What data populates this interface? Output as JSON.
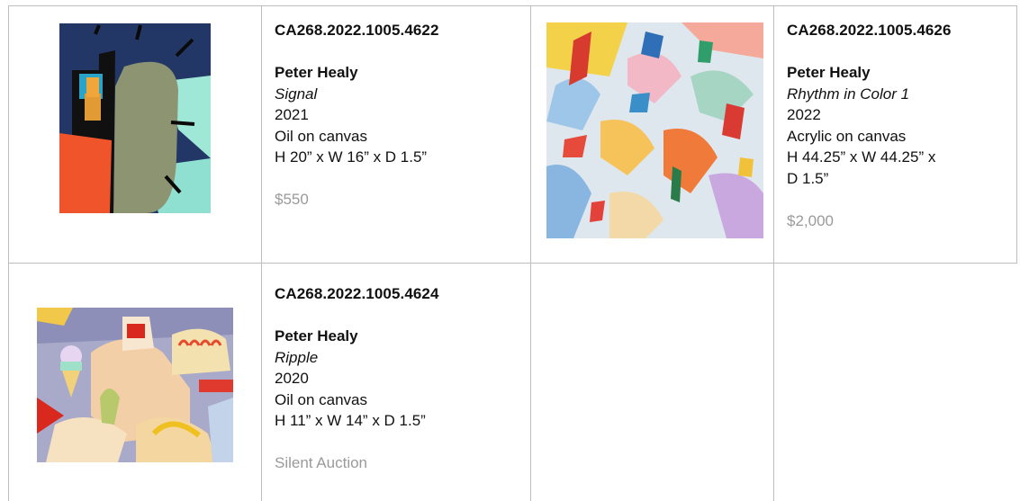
{
  "artworks": [
    {
      "code": "CA268.2022.1005.4622",
      "artist": "Peter Healy",
      "title": "Signal",
      "year": "2021",
      "medium": "Oil on canvas",
      "dimensions": "H 20” x W 16” x D 1.5”",
      "price": "$550"
    },
    {
      "code": "CA268.2022.1005.4626",
      "artist": "Peter Healy",
      "title": "Rhythm in Color 1",
      "year": "2022",
      "medium": "Acrylic on canvas",
      "dimensions_line1": "H 44.25” x W 44.25” x",
      "dimensions_line2": "D 1.5”",
      "price": "$2,000"
    },
    {
      "code": "CA268.2022.1005.4624",
      "artist": "Peter Healy",
      "title": "Ripple",
      "year": "2020",
      "medium": "Oil on canvas",
      "dimensions": "H 11” x W 14” x D 1.5”",
      "price": "Silent Auction"
    }
  ],
  "colors": {
    "grid_line": "#bdbdbd",
    "price_text": "#9a9a9a"
  }
}
